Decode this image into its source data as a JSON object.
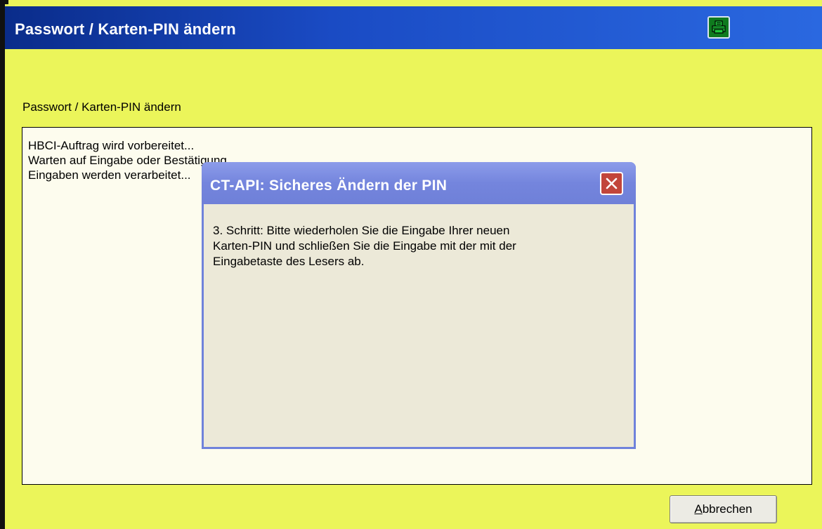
{
  "window": {
    "title": "Passwort / Karten-PIN ändern",
    "print_icon": "printer-icon"
  },
  "section": {
    "label": "Passwort / Karten-PIN ändern"
  },
  "log": {
    "lines": [
      "HBCI-Auftrag wird vorbereitet...",
      "Warten auf Eingabe oder Bestätigung...",
      "Eingaben werden verarbeitet..."
    ]
  },
  "buttons": {
    "cancel_prefix": "A",
    "cancel_rest": "bbrechen"
  },
  "dialog": {
    "title": "CT-API: Sicheres Ändern der PIN",
    "close_icon": "close-icon",
    "message_lines": [
      "3. Schritt: Bitte wiederholen Sie die Eingabe Ihrer neuen",
      "Karten-PIN und schließen Sie die Eingabe mit der mit der",
      "Eingabetaste des Lesers ab."
    ]
  },
  "colors": {
    "background": "#ebf55a",
    "titlebar": "#1a4bc4",
    "dialog_titlebar": "#7485dd",
    "close_button": "#c2453b",
    "print_button": "#0f7a1e"
  }
}
